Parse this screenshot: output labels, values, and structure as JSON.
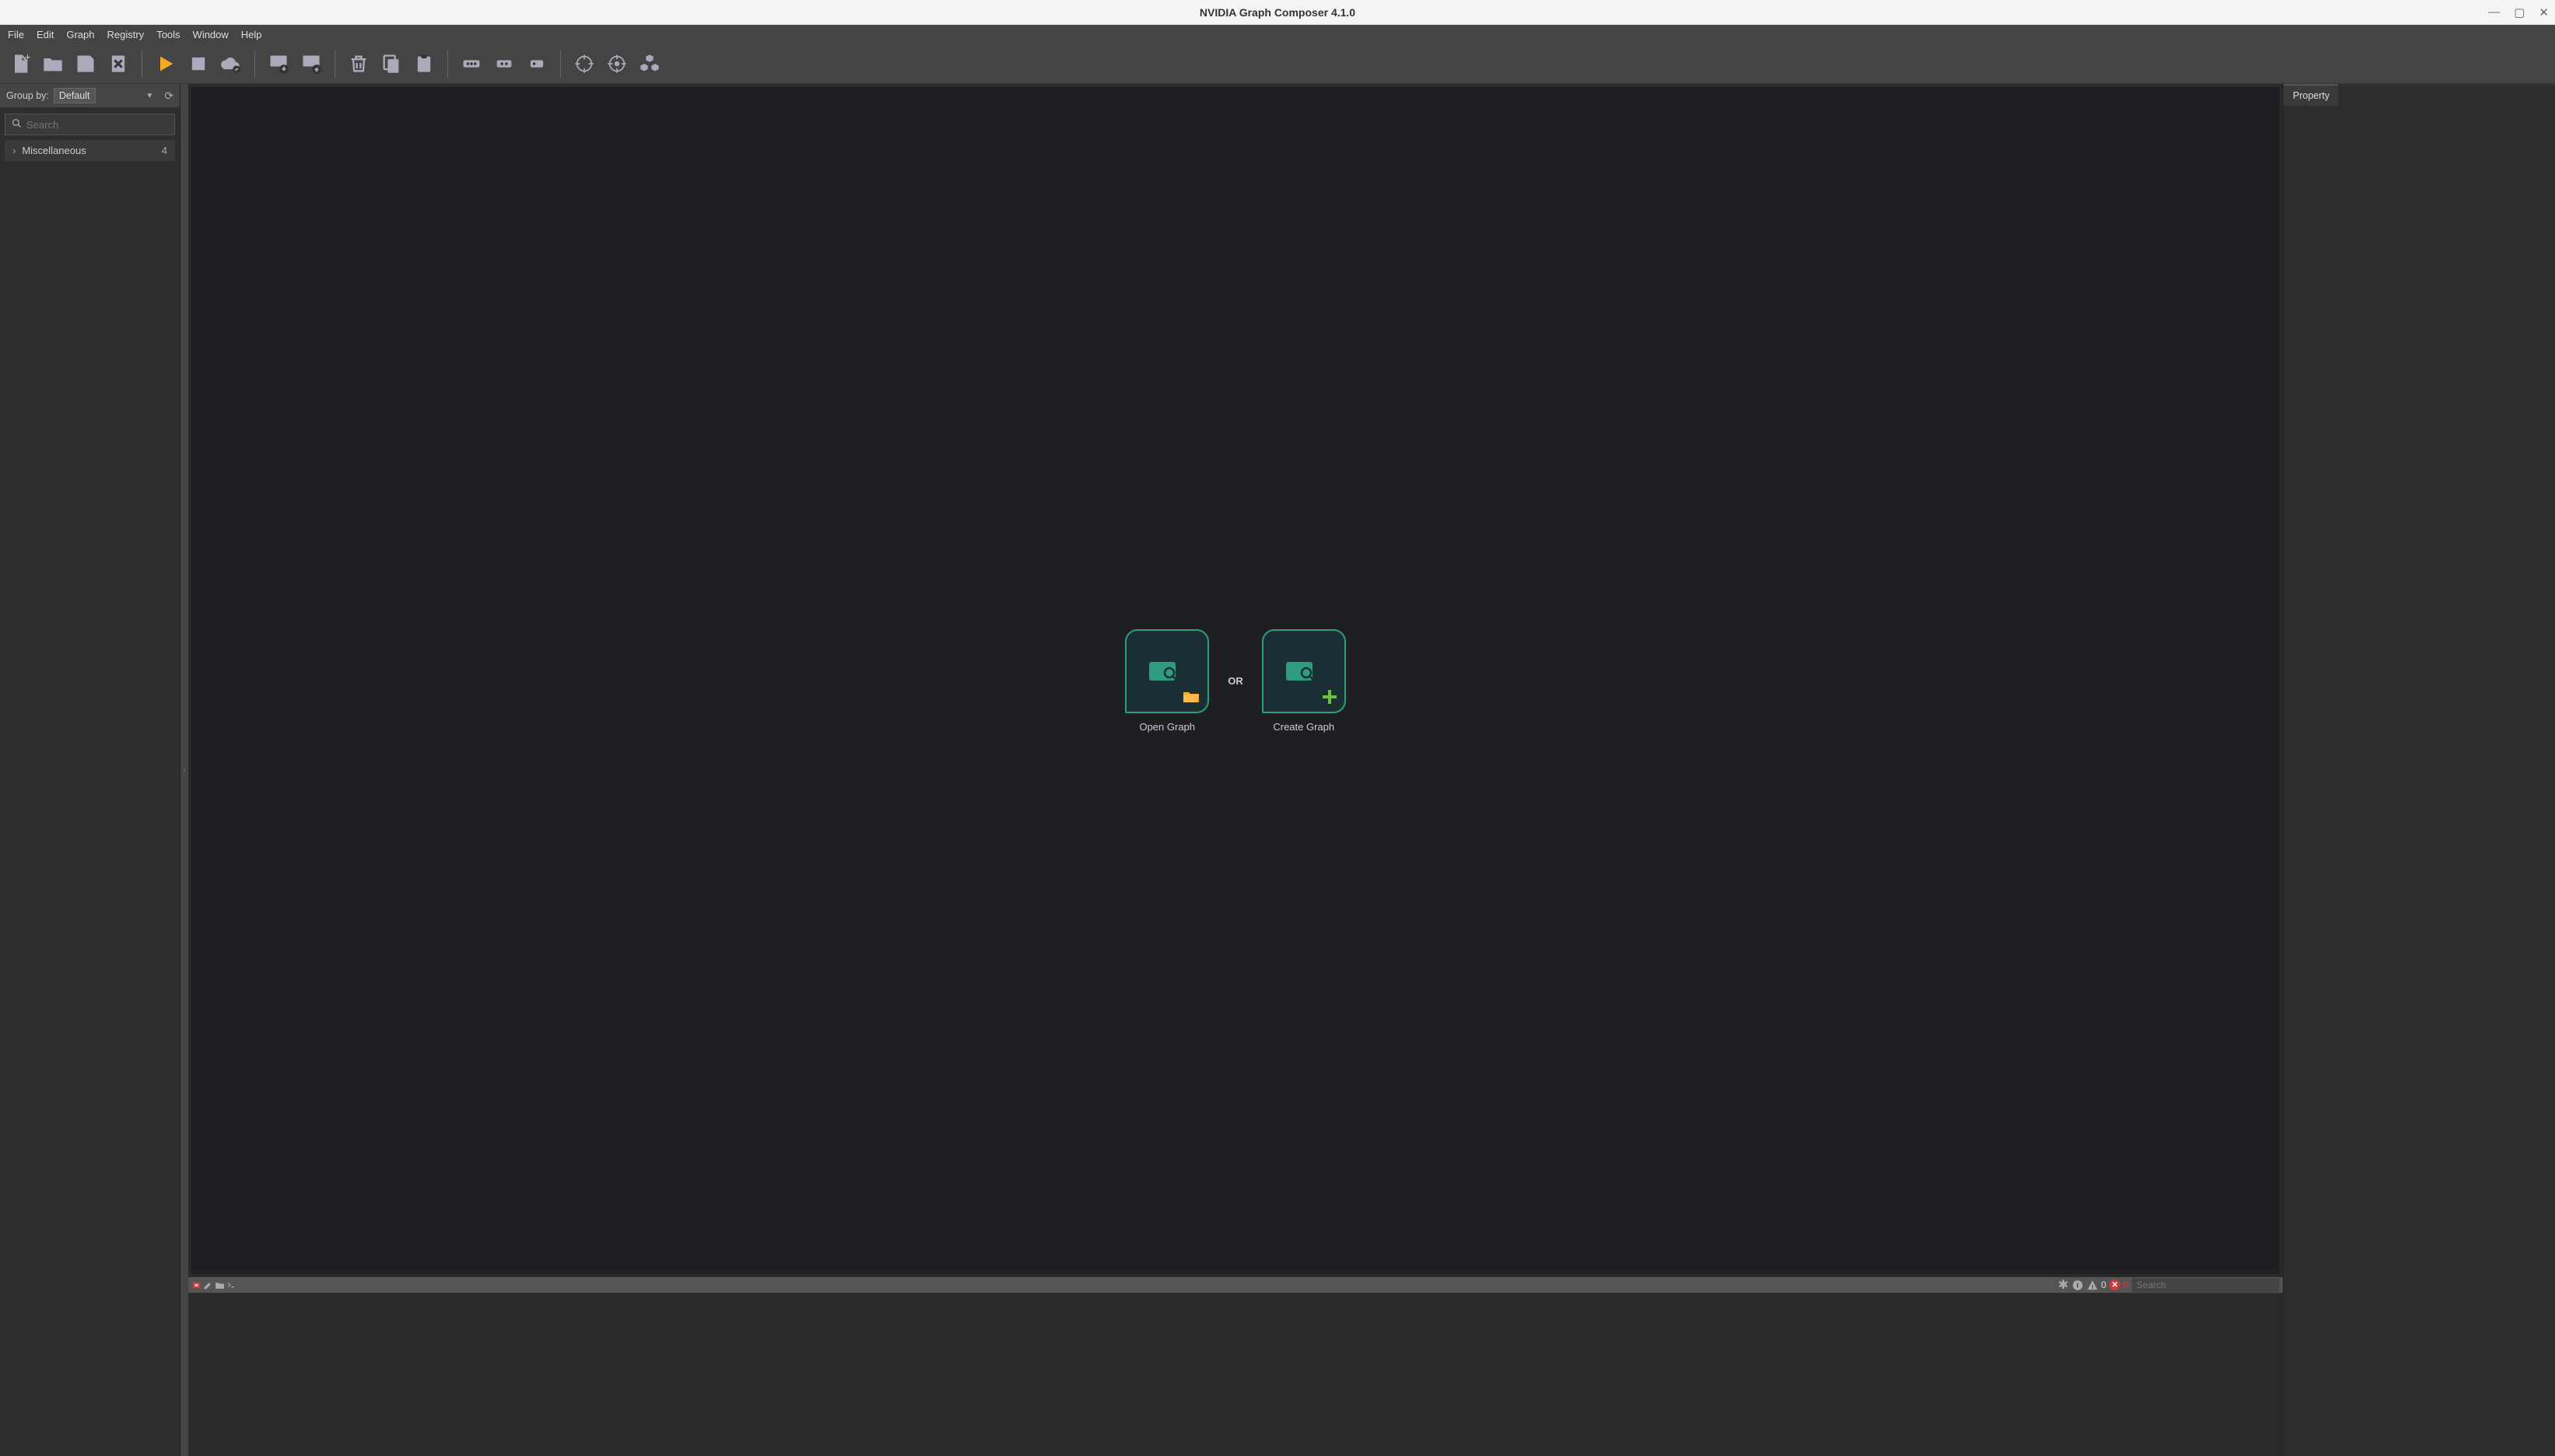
{
  "titlebar": {
    "title": "NVIDIA Graph Composer 4.1.0"
  },
  "menubar": {
    "items": [
      "File",
      "Edit",
      "Graph",
      "Registry",
      "Tools",
      "Window",
      "Help"
    ]
  },
  "left": {
    "groupby_label": "Group by:",
    "groupby_value": "Default",
    "search_placeholder": "Search",
    "tree": [
      {
        "label": "Miscellaneous",
        "count": "4"
      }
    ]
  },
  "canvas": {
    "open_label": "Open Graph",
    "or": "OR",
    "create_label": "Create Graph"
  },
  "console": {
    "warn_count": "0",
    "error_count": "0",
    "search_placeholder": "Search"
  },
  "right": {
    "tab": "Property"
  }
}
